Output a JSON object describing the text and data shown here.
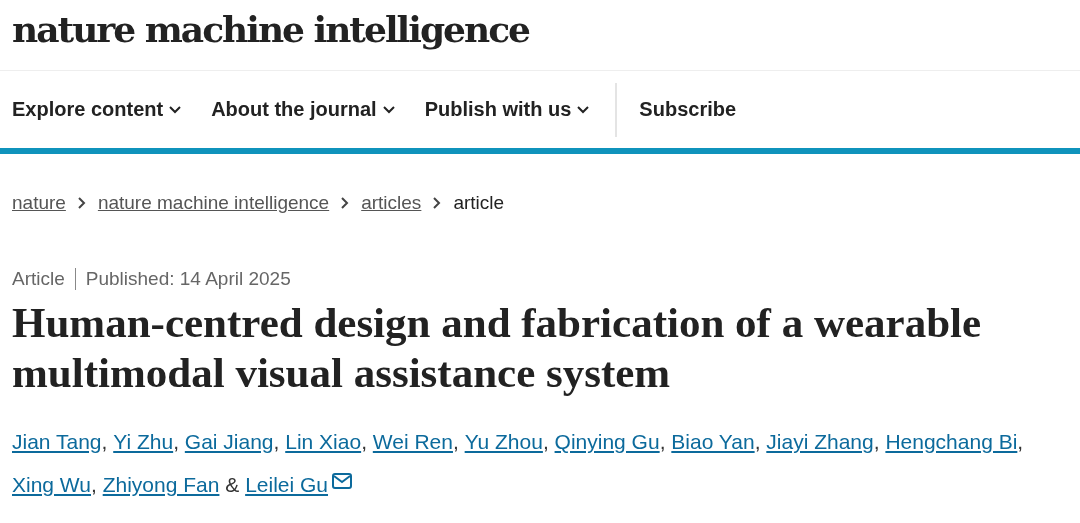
{
  "logo": "nature machine intelligence",
  "nav": [
    {
      "label": "Explore content",
      "dropdown": true
    },
    {
      "label": "About the journal",
      "dropdown": true
    },
    {
      "label": "Publish with us",
      "dropdown": true
    },
    {
      "label": "Subscribe",
      "dropdown": false
    }
  ],
  "breadcrumb": [
    {
      "label": "nature",
      "link": true
    },
    {
      "label": "nature machine intelligence",
      "link": true
    },
    {
      "label": "articles",
      "link": true
    },
    {
      "label": "article",
      "link": false
    }
  ],
  "article_type": "Article",
  "published": "Published: 14 April 2025",
  "title": "Human-centred design and fabrication of a wearable multimodal visual assistance system",
  "authors": [
    {
      "name": "Jian Tang",
      "separator": ",",
      "corresponding": false
    },
    {
      "name": "Yi Zhu",
      "separator": ",",
      "corresponding": false
    },
    {
      "name": "Gai Jiang",
      "separator": ",",
      "corresponding": false
    },
    {
      "name": "Lin Xiao",
      "separator": ",",
      "corresponding": false
    },
    {
      "name": "Wei Ren",
      "separator": ",",
      "corresponding": false
    },
    {
      "name": "Yu Zhou",
      "separator": ",",
      "corresponding": false
    },
    {
      "name": "Qinying Gu",
      "separator": ",",
      "corresponding": false
    },
    {
      "name": "Biao Yan",
      "separator": ",",
      "corresponding": false
    },
    {
      "name": "Jiayi Zhang",
      "separator": ",",
      "corresponding": false
    },
    {
      "name": "Hengchang Bi",
      "separator": ",",
      "corresponding": false
    },
    {
      "name": "Xing Wu",
      "separator": ",",
      "corresponding": false
    },
    {
      "name": "Zhiyong Fan",
      "corresponding": false
    },
    {
      "kind": "conjunction",
      "text": "&"
    },
    {
      "name": "Leilei Gu",
      "corresponding": true
    }
  ]
}
